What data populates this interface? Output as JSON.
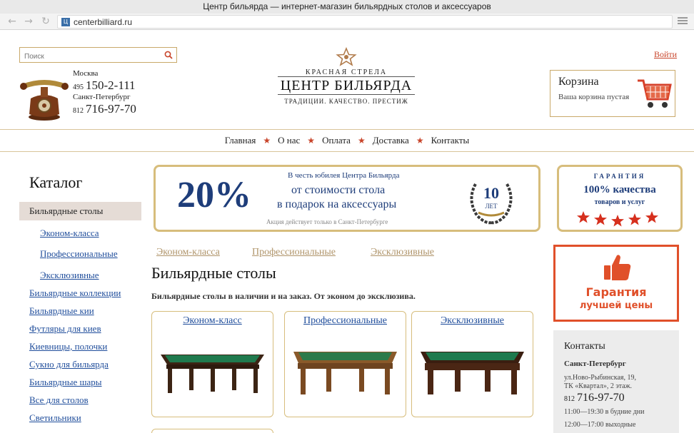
{
  "browser": {
    "title": "Центр бильярда — интернет-магазин бильярдных столов и аксессуаров",
    "url": "centerbilliard.ru",
    "favicon_letter": "Ц"
  },
  "header": {
    "search_placeholder": "Поиск",
    "contacts": [
      {
        "city": "Москва",
        "code": "495",
        "number": "150-2-111"
      },
      {
        "city": "Санкт-Петербург",
        "code": "812",
        "number": "716-97-70"
      }
    ],
    "logo": {
      "subtitle": "КРАСНАЯ СТРЕЛА",
      "name": "ЦЕНТР БИЛЬЯРДА",
      "tagline": "ТРАДИЦИИ. КАЧЕСТВО. ПРЕСТИЖ"
    },
    "login_label": "Войти",
    "cart": {
      "title": "Корзина",
      "status": "Ваша корзина пустая"
    }
  },
  "menu": [
    "Главная",
    "О нас",
    "Оплата",
    "Доставка",
    "Контакты"
  ],
  "sidebar": {
    "title": "Каталог",
    "active": "Бильярдные столы",
    "subitems": [
      "Эконом-класса",
      "Профессиональные",
      "Эксклюзивные"
    ],
    "items": [
      "Бильярдные коллекции",
      "Бильярдные кии",
      "Футляры для киев",
      "Киевницы, полочки",
      "Сукно для бильярда",
      "Бильярдные шары",
      "Все для столов",
      "Светильники"
    ]
  },
  "banner_promo": {
    "percent": "20%",
    "top": "В честь юбилея Центра Бильярда",
    "line1": "от стоимости стола",
    "line2": "в подарок на аксессуары",
    "note": "Акция действует только в Санкт-Петербурге",
    "badge_number": "10",
    "badge_word": "ЛЕТ"
  },
  "banner_guarantee": {
    "title": "ГАРАНТИЯ",
    "main": "100% качества",
    "sub": "товаров и услуг"
  },
  "best_price": {
    "line1": "Гарантия",
    "line2": "лучшей цены"
  },
  "content": {
    "tabs": [
      "Эконом-класса",
      "Профессиональные",
      "Эксклюзивные"
    ],
    "title": "Бильярдные столы",
    "description": "Бильярдные столы в наличии и на заказ. От эконом до эксклюзива.",
    "cards": [
      "Эконом-класс",
      "Профессиональные",
      "Эксклюзивные"
    ]
  },
  "contacts_box": {
    "title": "Контакты",
    "city": "Санкт-Петербург",
    "address1": "ул.Ново-Рыбинская, 19,",
    "address2": "ТК «Квартал», 2 этаж.",
    "phone_code": "812",
    "phone_number": "716-97-70",
    "hours1": "11:00—19:30 в будние дни",
    "hours2": "12:00—17:00 выходные"
  },
  "colors": {
    "accent_red": "#c8442a",
    "gold": "#d7bd7c",
    "navy": "#1e3d7a",
    "link": "#1f4d9b",
    "promo_orange": "#e0502a"
  }
}
